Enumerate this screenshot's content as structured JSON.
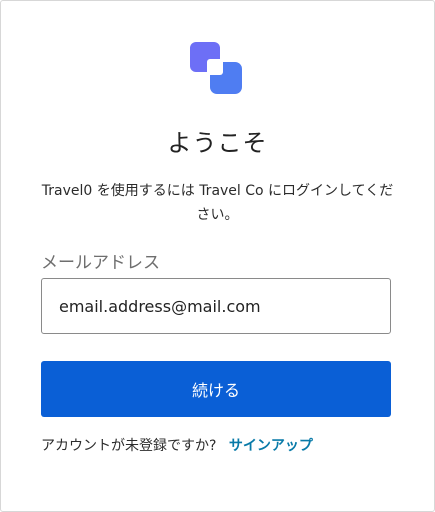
{
  "brand": {
    "logo_icon": "overlapping-squares-logo-icon",
    "primary_color": "#0a5fd6",
    "logo_color_light": "#6d6ff6",
    "logo_color_dark": "#4f7df2",
    "link_color": "#087aa8"
  },
  "login": {
    "title": "ようこそ",
    "subtitle": "Travel0 を使用するには Travel Co にログインしてください。",
    "email_label": "メールアドレス",
    "email_value": "email.address@mail.com",
    "continue_label": "続ける",
    "no_account_text": "アカウントが未登録ですか?",
    "signup_label": "サインアップ"
  }
}
